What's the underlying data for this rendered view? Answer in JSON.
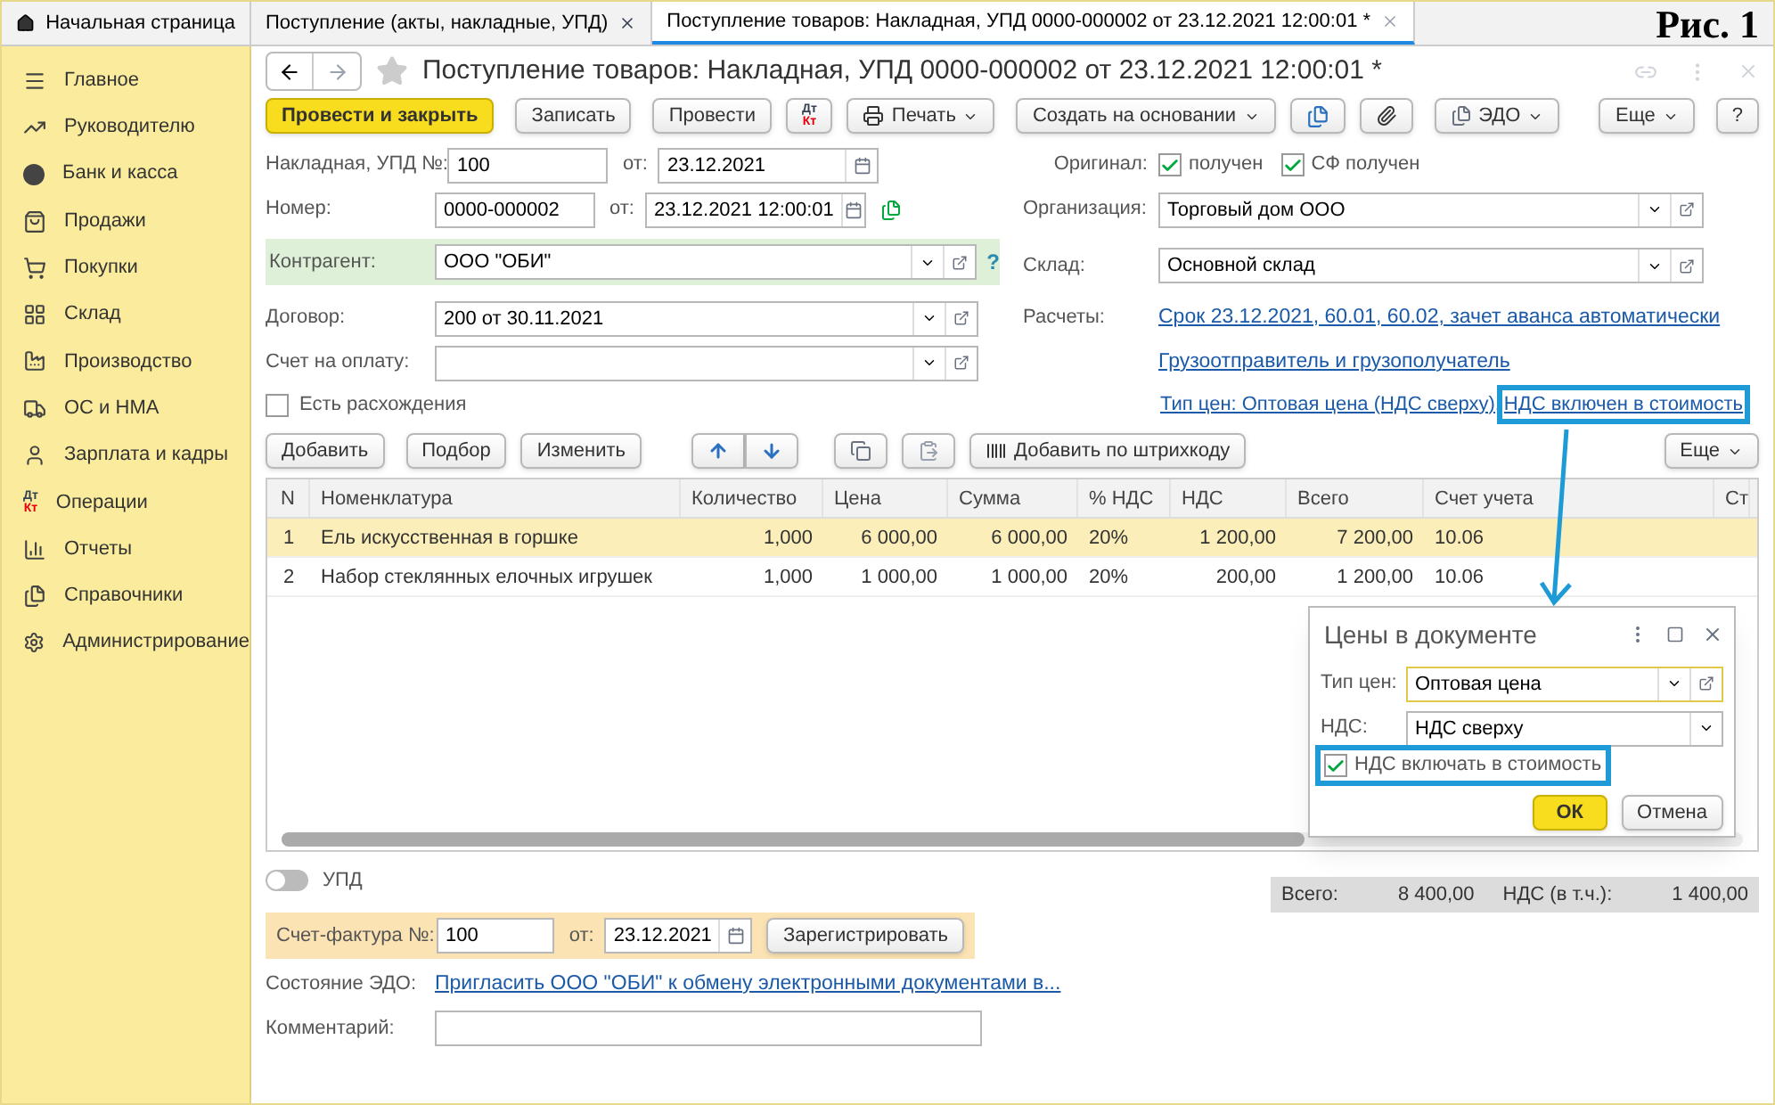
{
  "tabs": [
    {
      "label": "Начальная страница",
      "kind": "home",
      "selected": false,
      "closable": false
    },
    {
      "label": "Поступление (акты, накладные, УПД)",
      "kind": "doc",
      "selected": false,
      "closable": true
    },
    {
      "label": "Поступление товаров: Накладная, УПД 0000-000002 от 23.12.2021 12:00:01 *",
      "kind": "doc",
      "selected": true,
      "closable": true
    }
  ],
  "figure_label": "Рис. 1",
  "sidebar": {
    "items": [
      {
        "label": "Главное"
      },
      {
        "label": "Руководителю"
      },
      {
        "label": "Банк и касса"
      },
      {
        "label": "Продажи"
      },
      {
        "label": "Покупки"
      },
      {
        "label": "Склад"
      },
      {
        "label": "Производство"
      },
      {
        "label": "ОС и НМА"
      },
      {
        "label": "Зарплата и кадры"
      },
      {
        "label": "Операции",
        "icon_text": [
          "Дт",
          "Кт"
        ]
      },
      {
        "label": "Отчеты"
      },
      {
        "label": "Справочники"
      },
      {
        "label": "Администрирование"
      }
    ]
  },
  "form": {
    "title": "Поступление товаров: Накладная, УПД 0000-000002 от 23.12.2021 12:00:01 *",
    "toolbar": {
      "post_close": "Провести и закрыть",
      "save": "Записать",
      "post": "Провести",
      "dtkt": [
        "Дт",
        "Кт"
      ],
      "print": "Печать",
      "create_based": "Создать на основании",
      "edo": "ЭДО",
      "more": "Еще",
      "help": "?"
    },
    "left_fields": [
      {
        "label": "Накладная, УПД №:",
        "value": "100",
        "date_label": "от:",
        "date": "23.12.2021"
      },
      {
        "label": "Номер:",
        "value": "0000-000002",
        "date_label": "от:",
        "date": "23.12.2021 12:00:01"
      }
    ],
    "counterparty": {
      "label": "Контрагент:",
      "value": "ООО \"ОБИ\"",
      "help": "?"
    },
    "contract": {
      "label": "Договор:",
      "value": "200 от 30.11.2021"
    },
    "invoice_for_payment": {
      "label": "Счет на оплату:"
    },
    "discrepancies": {
      "label": "Есть расхождения",
      "checked": false
    },
    "original": {
      "label": "Оригинал:",
      "checks": [
        {
          "label": "получен",
          "checked": true
        },
        {
          "label": "СФ получен",
          "checked": true
        }
      ]
    },
    "organization": {
      "label": "Организация:",
      "value": "Торговый дом ООО"
    },
    "warehouse": {
      "label": "Склад:",
      "value": "Основной склад"
    },
    "settlements": {
      "label": "Расчеты:",
      "link": "Срок 23.12.2021, 60.01, 60.02, зачет аванса автоматически"
    },
    "shipper_link": "Грузоотправитель и грузополучатель",
    "price_links": [
      {
        "text": "Тип цен: Оптовая цена (НДС сверху),",
        "highlighted": false
      },
      {
        "text": "НДС включен в стоимость",
        "highlighted": true
      }
    ]
  },
  "table_toolbar": {
    "add": "Добавить",
    "select": "Подбор",
    "edit": "Изменить",
    "barcode": "Добавить по штрихкоду",
    "more": "Еще"
  },
  "table": {
    "columns": [
      "N",
      "Номенклатура",
      "Количество",
      "Цена",
      "Сумма",
      "% НДС",
      "НДС",
      "Всего",
      "Счет учета",
      "Ст"
    ],
    "rows": [
      {
        "selected": true,
        "cells": [
          "1",
          "Ель искусственная в горшке",
          "1,000",
          "6 000,00",
          "6 000,00",
          "20%",
          "1 200,00",
          "7 200,00",
          "10.06"
        ]
      },
      {
        "selected": false,
        "cells": [
          "2",
          "Набор стеклянных елочных игрушек",
          "1,000",
          "1 000,00",
          "1 000,00",
          "20%",
          "200,00",
          "1 200,00",
          "10.06"
        ]
      }
    ]
  },
  "upd": {
    "label": "УПД",
    "on": false
  },
  "totals": {
    "total_label": "Всего:",
    "total": "8 400,00",
    "vat_label": "НДС (в т.ч.):",
    "vat": "1 400,00"
  },
  "invoice": {
    "label": "Счет-фактура №:",
    "value": "100",
    "date_label": "от:",
    "date": "23.12.2021",
    "register": "Зарегистрировать"
  },
  "edo_state": {
    "label": "Состояние ЭДО:",
    "link": "Пригласить ООО \"ОБИ\" к обмену электронными документами в..."
  },
  "comment": {
    "label": "Комментарий:"
  },
  "dialog": {
    "title": "Цены в документе",
    "price_type": {
      "label": "Тип цен:",
      "value": "Оптовая цена"
    },
    "vat": {
      "label": "НДС:",
      "value": "НДС сверху"
    },
    "include_vat": {
      "label": "НДС включать в стоимость",
      "checked": true,
      "highlighted": true
    },
    "ok": "ОК",
    "cancel": "Отмена"
  }
}
